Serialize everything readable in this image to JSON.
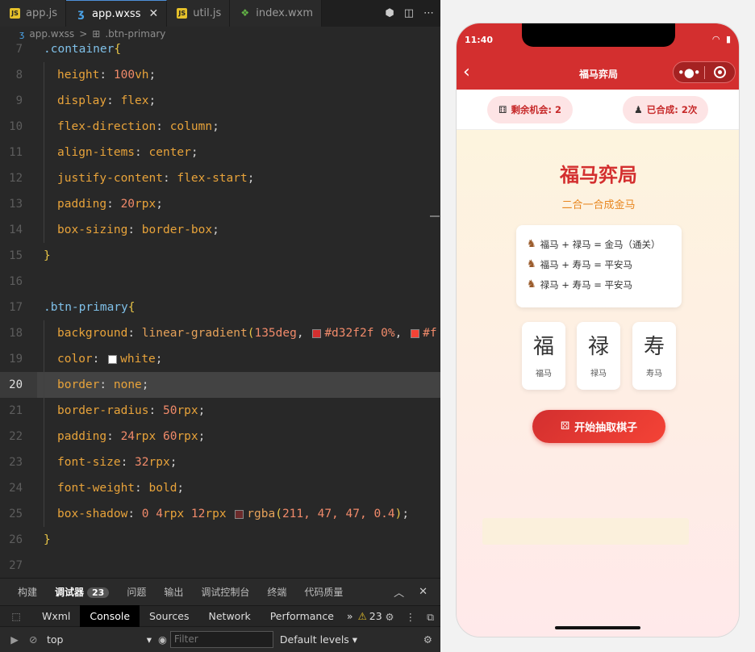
{
  "editor": {
    "tabs": [
      {
        "label": "app.js",
        "icon": "js"
      },
      {
        "label": "app.wxss",
        "icon": "wxss"
      },
      {
        "label": "util.js",
        "icon": "js"
      },
      {
        "label": "index.wxm",
        "icon": "wxml"
      }
    ],
    "breadcrumb": {
      "file": "app.wxss",
      "separator": ">",
      "symbol": ".btn-primary"
    },
    "lines": [
      {
        "n": "7",
        "t": ".container {"
      },
      {
        "n": "8",
        "t": "  height: 100vh;"
      },
      {
        "n": "9",
        "t": "  display: flex;"
      },
      {
        "n": "10",
        "t": "  flex-direction: column;"
      },
      {
        "n": "11",
        "t": "  align-items: center;"
      },
      {
        "n": "12",
        "t": "  justify-content: flex-start;"
      },
      {
        "n": "13",
        "t": "  padding: 20rpx;"
      },
      {
        "n": "14",
        "t": "  box-sizing: border-box;"
      },
      {
        "n": "15",
        "t": "}"
      },
      {
        "n": "16",
        "t": ""
      },
      {
        "n": "17",
        "t": ".btn-primary {"
      },
      {
        "n": "18",
        "t": "  background: linear-gradient(135deg, #d32f2f 0%, #f"
      },
      {
        "n": "19",
        "t": "  color: white;"
      },
      {
        "n": "20",
        "t": "  border: none;"
      },
      {
        "n": "21",
        "t": "  border-radius: 50rpx;"
      },
      {
        "n": "22",
        "t": "  padding: 24rpx 60rpx;"
      },
      {
        "n": "23",
        "t": "  font-size: 32rpx;"
      },
      {
        "n": "24",
        "t": "  font-weight: bold;"
      },
      {
        "n": "25",
        "t": "  box-shadow: 0 4rpx 12rpx rgba(211, 47, 47, 0.4);"
      },
      {
        "n": "26",
        "t": "}"
      },
      {
        "n": "27",
        "t": ""
      }
    ],
    "current_line": "20"
  },
  "panel": {
    "tabs": [
      "构建",
      "调试器",
      "问题",
      "输出",
      "调试控制台",
      "终端",
      "代码质量"
    ],
    "debugger_badge": "23",
    "devtools_tabs": [
      "Wxml",
      "Console",
      "Sources",
      "Network",
      "Performance"
    ],
    "more": "»",
    "warning_count": "23",
    "context": "top",
    "filter_placeholder": "Filter",
    "levels": "Default levels"
  },
  "simulator": {
    "time": "11:40",
    "nav_title": "福马弈局",
    "stats": {
      "chances": "剩余机会: 2",
      "merged": "已合成: 2次"
    },
    "title": "福马弈局",
    "subtitle": "二合一合成金马",
    "rules": [
      "福马 + 禄马 = 金马（通关）",
      "福马 + 寿马 = 平安马",
      "禄马 + 寿马 = 平安马"
    ],
    "pieces": [
      {
        "char": "福",
        "name": "福马"
      },
      {
        "char": "禄",
        "name": "禄马"
      },
      {
        "char": "寿",
        "name": "寿马"
      }
    ],
    "start_button": "开始抽取棋子",
    "colors": {
      "primary": "#d32f2f",
      "accent": "#f44336",
      "subtitle": "#e8861f"
    }
  }
}
